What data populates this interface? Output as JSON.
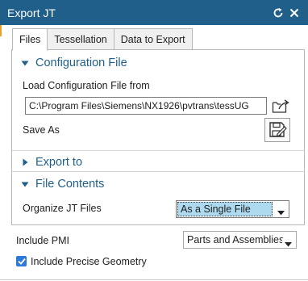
{
  "window": {
    "title": "Export JT"
  },
  "tabs": [
    {
      "label": "Files",
      "active": true
    },
    {
      "label": "Tessellation",
      "active": false
    },
    {
      "label": "Data to Export",
      "active": false
    }
  ],
  "configuration": {
    "header": "Configuration File",
    "load_label": "Load Configuration File from",
    "path_value": "C:\\Program Files\\Siemens\\NX1926\\pvtrans\\tessUG",
    "save_as_label": "Save As"
  },
  "export_to": {
    "header": "Export to"
  },
  "file_contents": {
    "header": "File Contents",
    "organize_label": "Organize JT Files",
    "organize_value": "As a Single File"
  },
  "pmi": {
    "label": "Include PMI",
    "value": "Parts and Assemblies"
  },
  "precise_geometry": {
    "label": "Include Precise Geometry",
    "checked": true
  },
  "colors": {
    "title_bar": "#1f5f8a",
    "accent": "#1f5f8a",
    "highlight": "#aedaf0",
    "checkbox": "#2d7ad6"
  }
}
